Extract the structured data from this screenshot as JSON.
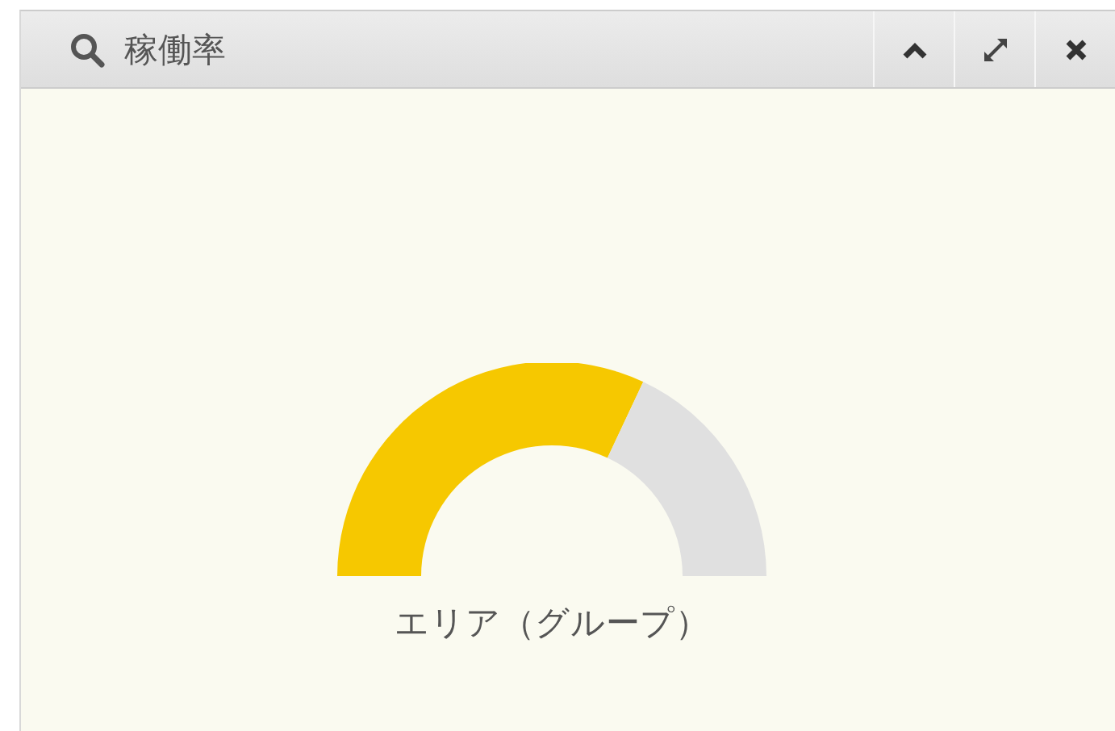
{
  "panel": {
    "title": "稼働率",
    "buttons": [
      {
        "kind": "collapse"
      },
      {
        "kind": "expand"
      },
      {
        "kind": "close"
      }
    ]
  },
  "gauge": {
    "label": "エリア（グループ）"
  }
}
